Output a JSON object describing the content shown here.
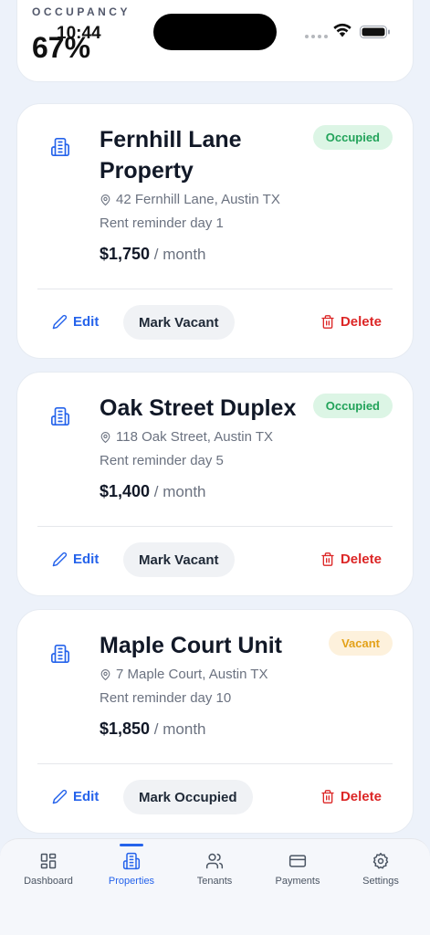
{
  "status_bar": {
    "time": "10:44"
  },
  "summary": {
    "label": "OCCUPANCY",
    "value": "67%"
  },
  "properties": [
    {
      "name": "Fernhill Lane Property",
      "status": "Occupied",
      "address": "42 Fernhill Lane, Austin TX",
      "reminder": "Rent reminder day 1",
      "rent": "$1,750",
      "rent_suffix": "/ month",
      "edit_label": "Edit",
      "mark_label": "Mark Vacant",
      "delete_label": "Delete"
    },
    {
      "name": "Oak Street Duplex",
      "status": "Occupied",
      "address": "118 Oak Street, Austin TX",
      "reminder": "Rent reminder day 5",
      "rent": "$1,400",
      "rent_suffix": "/ month",
      "edit_label": "Edit",
      "mark_label": "Mark Vacant",
      "delete_label": "Delete"
    },
    {
      "name": "Maple Court Unit",
      "status": "Vacant",
      "address": "7 Maple Court, Austin TX",
      "reminder": "Rent reminder day 10",
      "rent": "$1,850",
      "rent_suffix": "/ month",
      "edit_label": "Edit",
      "mark_label": "Mark Occupied",
      "delete_label": "Delete"
    }
  ],
  "tabs": [
    {
      "label": "Dashboard",
      "icon": "dashboard-grid-icon"
    },
    {
      "label": "Properties",
      "icon": "building-icon",
      "active": true
    },
    {
      "label": "Tenants",
      "icon": "users-icon"
    },
    {
      "label": "Payments",
      "icon": "credit-card-icon"
    },
    {
      "label": "Settings",
      "icon": "gear-icon"
    }
  ],
  "colors": {
    "accent": "#2563eb",
    "occupied": "#22a35a",
    "vacant": "#e3a21a",
    "danger": "#dc2626",
    "background": "#edf2fa"
  }
}
